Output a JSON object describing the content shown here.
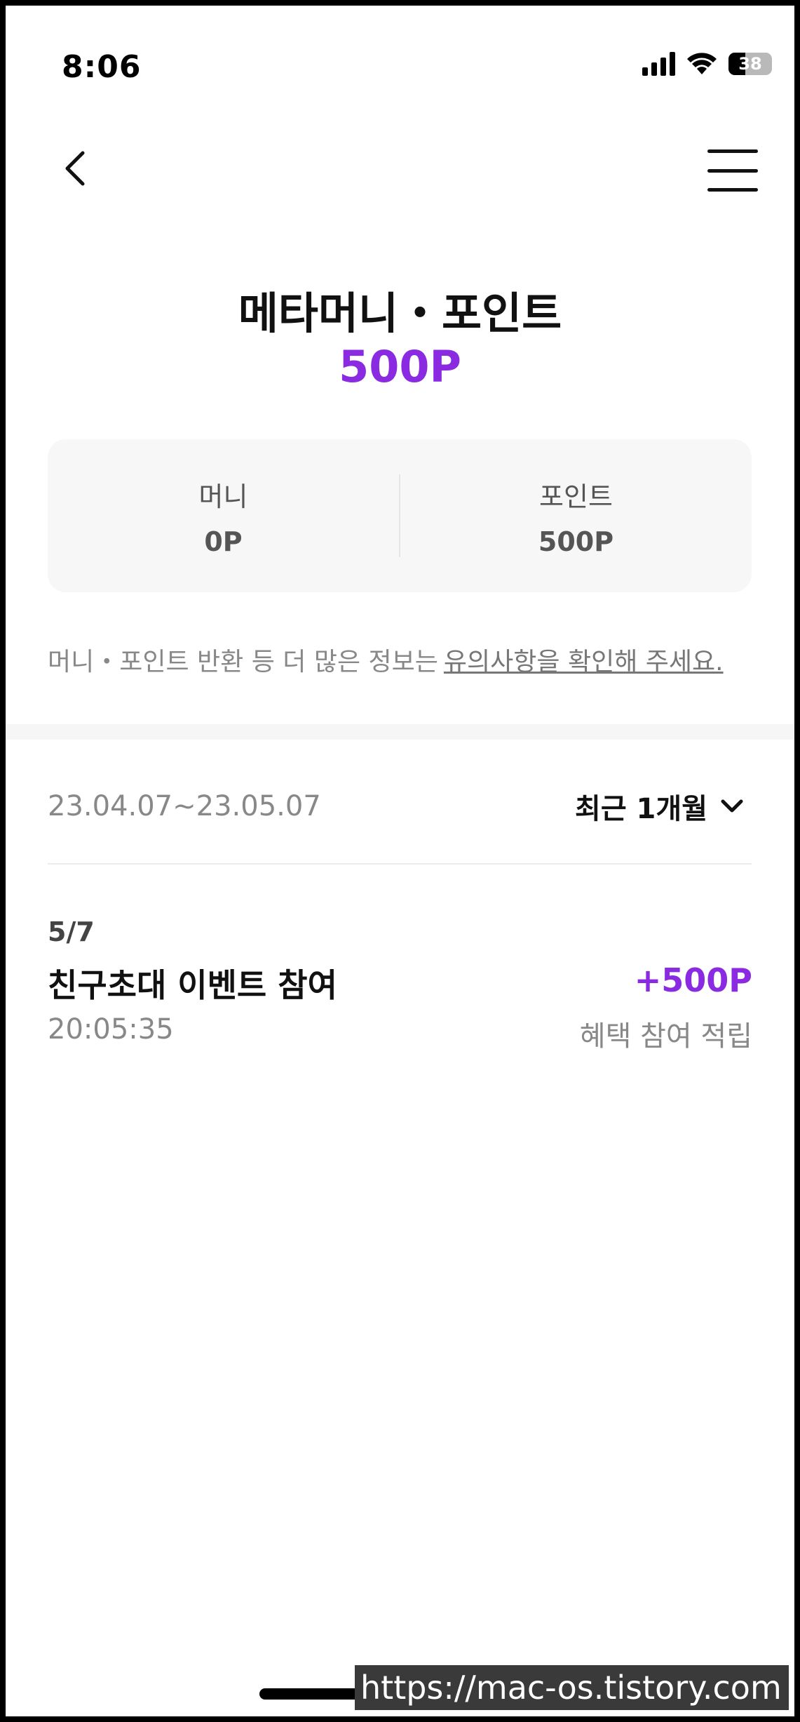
{
  "status_bar": {
    "time": "8:06",
    "battery_level": "38"
  },
  "header": {
    "title": "메타머니・포인트",
    "total_points": "500P"
  },
  "summary": {
    "money_label": "머니",
    "money_value": "0P",
    "point_label": "포인트",
    "point_value": "500P"
  },
  "notice": {
    "text": "머니・포인트 반환 등 더 많은 정보는",
    "link_text": "유의사항을 확인해 주세요."
  },
  "filter": {
    "date_range": "23.04.07~23.05.07",
    "period": "최근 1개월"
  },
  "history": [
    {
      "date": "5/7",
      "title": "친구초대 이벤트 참여",
      "time": "20:05:35",
      "amount": "+500P",
      "description": "혜택 참여 적립"
    }
  ],
  "watermark": "https://mac-os.tistory.com",
  "colors": {
    "accent": "#8a2be2",
    "card_bg": "#f7f7f7"
  }
}
